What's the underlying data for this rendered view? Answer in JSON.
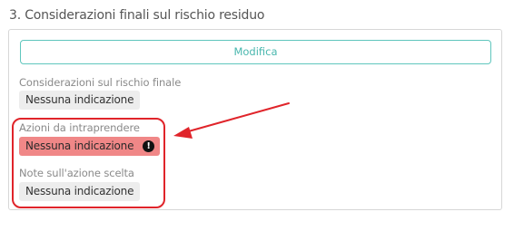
{
  "section": {
    "title": "3. Considerazioni finali sul rischio residuo"
  },
  "toolbar": {
    "edit_label": "Modifica"
  },
  "fields": [
    {
      "label": "Considerazioni sul rischio finale",
      "value": "Nessuna indicazione"
    },
    {
      "label": "Azioni da intraprendere",
      "value": "Nessuna indicazione",
      "status": "error"
    },
    {
      "label": "Note sull'azione scelta",
      "value": "Nessuna indicazione"
    }
  ],
  "icons": {
    "error_field_icon": "exclamation-icon"
  },
  "colors": {
    "accent": "#49b7ae",
    "error_chip": "#f08787",
    "annotation": "#e0242a",
    "chip_default": "#ededed"
  }
}
